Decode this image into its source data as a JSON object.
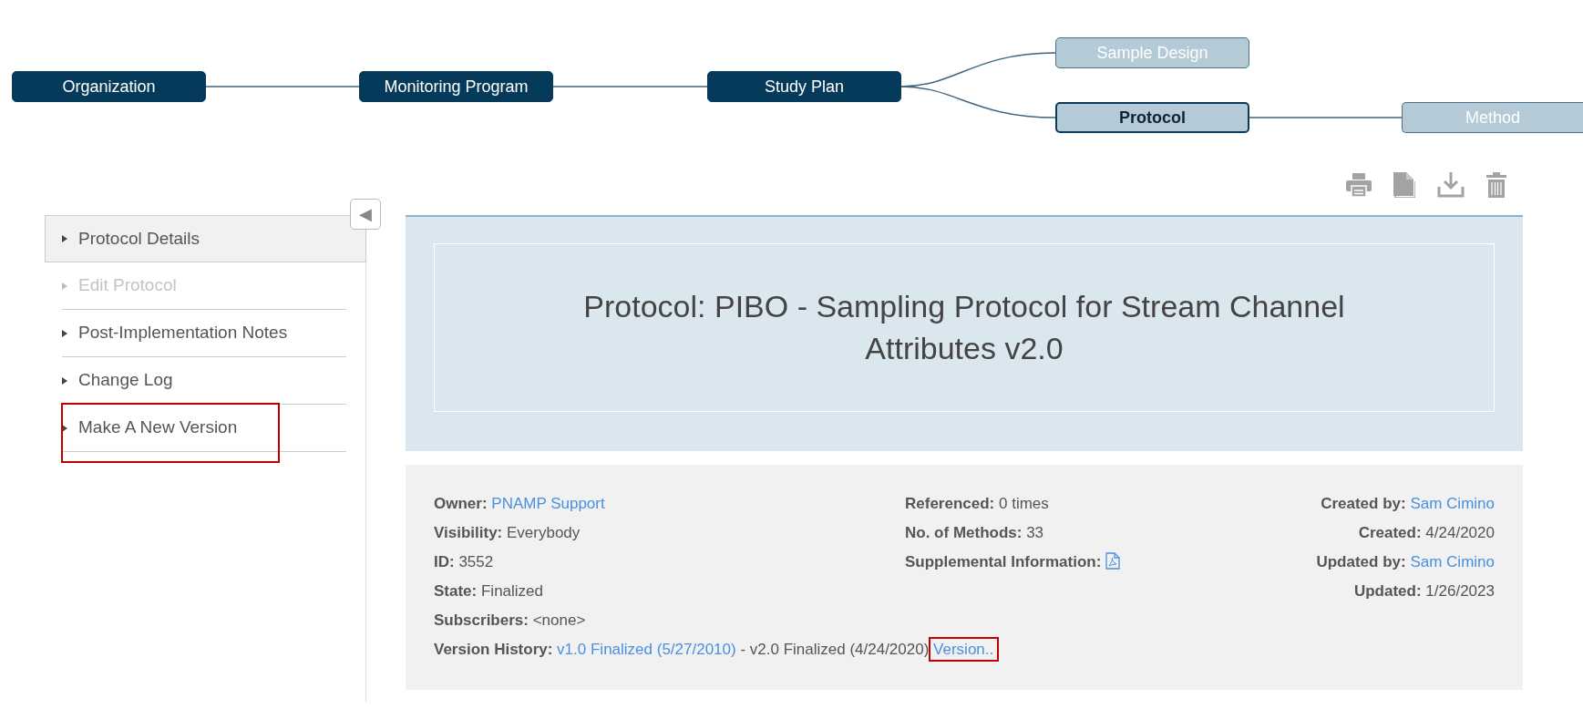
{
  "diagram": {
    "nodes": [
      {
        "label": "Organization",
        "kind": "dark",
        "selected": false,
        "children": [
          {
            "label": "Monitoring Program",
            "kind": "dark",
            "selected": false,
            "children": [
              {
                "label": "Study Plan",
                "kind": "dark",
                "selected": false,
                "children": [
                  {
                    "label": "Sample Design",
                    "kind": "light",
                    "selected": false
                  },
                  {
                    "label": "Protocol",
                    "kind": "light",
                    "selected": true,
                    "children": [
                      {
                        "label": "Method",
                        "kind": "light",
                        "selected": false
                      }
                    ]
                  }
                ]
              }
            ]
          }
        ]
      }
    ]
  },
  "sidebar": {
    "collapse_button": "◀",
    "items": [
      {
        "label": "Protocol Details",
        "selected": true,
        "disabled": false,
        "highlighted": false
      },
      {
        "label": "Edit Protocol",
        "selected": false,
        "disabled": true,
        "highlighted": false
      },
      {
        "label": "Post-Implementation Notes",
        "selected": false,
        "disabled": false,
        "highlighted": false
      },
      {
        "label": "Change Log",
        "selected": false,
        "disabled": false,
        "highlighted": false
      },
      {
        "label": "Make A New Version",
        "selected": false,
        "disabled": false,
        "highlighted": true
      }
    ]
  },
  "title": "Protocol: PIBO - Sampling Protocol for Stream Channel Attributes v2.0",
  "details": {
    "columns": [
      [
        {
          "label": "Owner:",
          "value": "PNAMP Support",
          "kind": "link"
        },
        {
          "label": "Visibility:",
          "value": "Everybody",
          "kind": "text"
        },
        {
          "label": "ID:",
          "value": "3552",
          "kind": "text"
        },
        {
          "label": "State:",
          "value": "Finalized",
          "kind": "text"
        },
        {
          "label": "Subscribers:",
          "value": "<none>",
          "kind": "text"
        }
      ],
      [
        {
          "label": "Referenced:",
          "value": "0 times",
          "kind": "text"
        },
        {
          "label": "No. of Methods:",
          "value": "33",
          "kind": "text"
        },
        {
          "label": "Supplemental Information:",
          "kind": "pdf"
        }
      ],
      [
        {
          "label": "Created by:",
          "value": "Sam Cimino",
          "kind": "link"
        },
        {
          "label": "Created:",
          "value": "4/24/2020",
          "kind": "text"
        },
        {
          "label": "Updated by:",
          "value": "Sam Cimino",
          "kind": "link"
        },
        {
          "label": "Updated:",
          "value": "1/26/2023",
          "kind": "text"
        }
      ]
    ],
    "version_history": {
      "label": "Version History:",
      "parts": [
        {
          "text": "v1.0 Finalized (5/27/2010)",
          "kind": "link",
          "highlighted": false
        },
        {
          "text": "- v2.0 Finalized (4/24/2020)",
          "kind": "text",
          "highlighted": false
        },
        {
          "text": "Version..",
          "kind": "link",
          "highlighted": true
        }
      ]
    }
  }
}
